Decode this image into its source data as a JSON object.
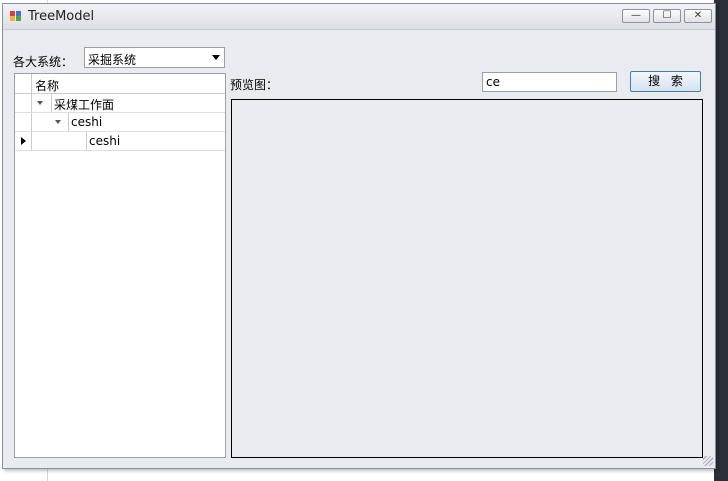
{
  "window": {
    "title": "TreeModel"
  },
  "controls": {
    "minimize": "—",
    "maximize": "☐",
    "close": "✕"
  },
  "system": {
    "label": "各大系统：",
    "selected": "采掘系统"
  },
  "tree": {
    "header": "名称",
    "rows": [
      {
        "text": "采煤工作面"
      },
      {
        "text": "ceshi"
      },
      {
        "text": "ceshi"
      }
    ]
  },
  "preview": {
    "label": "预览图："
  },
  "search": {
    "value": "ce",
    "button_label": "搜索"
  }
}
